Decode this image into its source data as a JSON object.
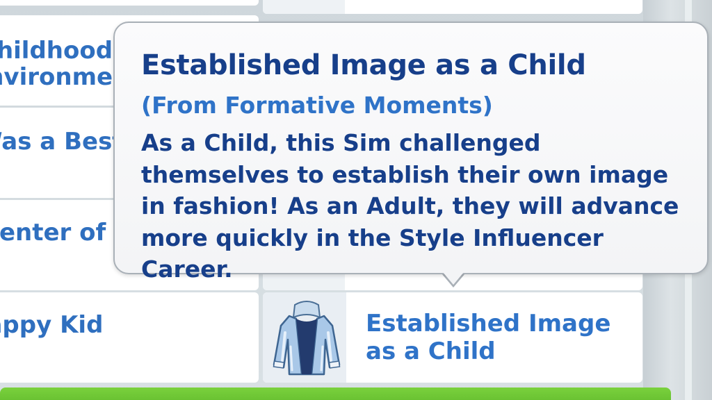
{
  "left_column": {
    "items": [
      {
        "label_line1": "Childhood",
        "label_line2": "Environment"
      },
      {
        "label_line1": "Was a Best"
      },
      {
        "label_line1": "Center of Attention"
      },
      {
        "label_line1": "Happy Kid"
      }
    ]
  },
  "right_column": {
    "selected_item": {
      "icon": "denim-jacket-icon",
      "label_line1": "Established Image",
      "label_line2": "as a Child"
    }
  },
  "tooltip": {
    "title": "Established Image as a Child",
    "subtitle": "(From Formative Moments)",
    "body": "As a Child, this Sim challenged themselves to establish their own image in fashion! As an Adult, they will advance more quickly in the Style Influencer Career."
  },
  "colors": {
    "title": "#173f8a",
    "subtitle": "#2f73c8",
    "tile_label": "#2f6fbf",
    "accent_green": "#6cc434"
  }
}
